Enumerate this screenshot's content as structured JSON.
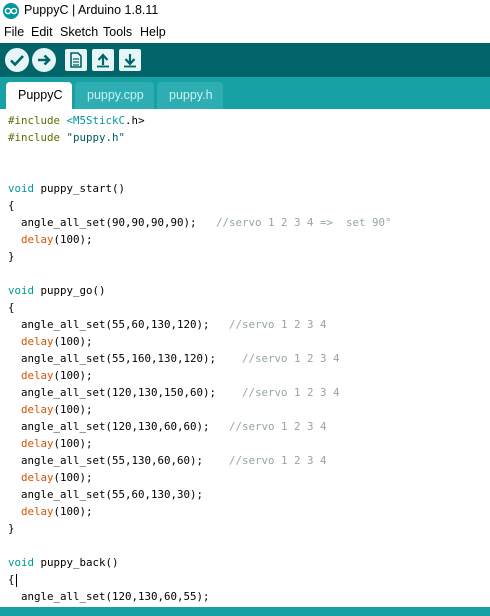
{
  "window": {
    "title": "PuppyC | Arduino 1.8.11"
  },
  "menu": [
    "File",
    "Edit",
    "Sketch",
    "Tools",
    "Help"
  ],
  "toolbar": {
    "buttons": [
      {
        "name": "verify-button",
        "icon": "checkmark-icon"
      },
      {
        "name": "upload-button",
        "icon": "arrow-right-icon"
      },
      {
        "name": "new-button",
        "icon": "document-icon"
      },
      {
        "name": "open-button",
        "icon": "arrow-up-icon"
      },
      {
        "name": "save-button",
        "icon": "arrow-down-icon"
      }
    ]
  },
  "tabs": [
    {
      "label": "PuppyC",
      "active": true
    },
    {
      "label": "puppy.cpp",
      "active": false
    },
    {
      "label": "puppy.h",
      "active": false
    }
  ],
  "code_lines": [
    [
      [
        "pp",
        "#include "
      ],
      [
        "type",
        "<M5StickC"
      ],
      [
        "",
        "."
      ],
      [
        "",
        "h"
      ],
      [
        "",
        ">"
      ]
    ],
    [
      [
        "pp",
        "#include "
      ],
      [
        "str",
        "\"puppy.h\""
      ]
    ],
    [],
    [],
    [
      [
        "type",
        "void"
      ],
      [
        "",
        " puppy_start()"
      ]
    ],
    [
      [
        "",
        "{"
      ]
    ],
    [
      [
        "",
        "  angle_all_set(90,90,90,90);   "
      ],
      [
        "cm",
        "//servo 1 2 3 4 =>  set 90°"
      ]
    ],
    [
      [
        "",
        "  "
      ],
      [
        "kw",
        "delay"
      ],
      [
        "",
        "(100);"
      ]
    ],
    [
      [
        "",
        "}"
      ]
    ],
    [],
    [
      [
        "type",
        "void"
      ],
      [
        "",
        " puppy_go()"
      ]
    ],
    [
      [
        "",
        "{"
      ]
    ],
    [
      [
        "",
        "  angle_all_set(55,60,130,120);   "
      ],
      [
        "cm",
        "//servo 1 2 3 4"
      ]
    ],
    [
      [
        "",
        "  "
      ],
      [
        "kw",
        "delay"
      ],
      [
        "",
        "(100);"
      ]
    ],
    [
      [
        "",
        "  angle_all_set(55,160,130,120);    "
      ],
      [
        "cm",
        "//servo 1 2 3 4"
      ]
    ],
    [
      [
        "",
        "  "
      ],
      [
        "kw",
        "delay"
      ],
      [
        "",
        "(100);"
      ]
    ],
    [
      [
        "",
        "  angle_all_set(120,130,150,60);    "
      ],
      [
        "cm",
        "//servo 1 2 3 4"
      ]
    ],
    [
      [
        "",
        "  "
      ],
      [
        "kw",
        "delay"
      ],
      [
        "",
        "(100);"
      ]
    ],
    [
      [
        "",
        "  angle_all_set(120,130,60,60);   "
      ],
      [
        "cm",
        "//servo 1 2 3 4"
      ]
    ],
    [
      [
        "",
        "  "
      ],
      [
        "kw",
        "delay"
      ],
      [
        "",
        "(100);"
      ]
    ],
    [
      [
        "",
        "  angle_all_set(55,130,60,60);    "
      ],
      [
        "cm",
        "//servo 1 2 3 4"
      ]
    ],
    [
      [
        "",
        "  "
      ],
      [
        "kw",
        "delay"
      ],
      [
        "",
        "(100);"
      ]
    ],
    [
      [
        "",
        "  angle_all_set(55,60,130,30);"
      ]
    ],
    [
      [
        "",
        "  "
      ],
      [
        "kw",
        "delay"
      ],
      [
        "",
        "(100);"
      ]
    ],
    [
      [
        "",
        "}"
      ]
    ],
    [],
    [
      [
        "type",
        "void"
      ],
      [
        "",
        " puppy_back()"
      ]
    ],
    [
      [
        "",
        "{"
      ]
    ],
    [
      [
        "",
        "  angle_all_set(120,130,60,55);"
      ]
    ]
  ],
  "colors": {
    "toolbar_bg": "#006468",
    "tabbar_bg": "#17a1a5",
    "keyword": "#d35400",
    "type": "#00979c",
    "preprocessor": "#5e6d03",
    "comment": "#95a5a6"
  }
}
